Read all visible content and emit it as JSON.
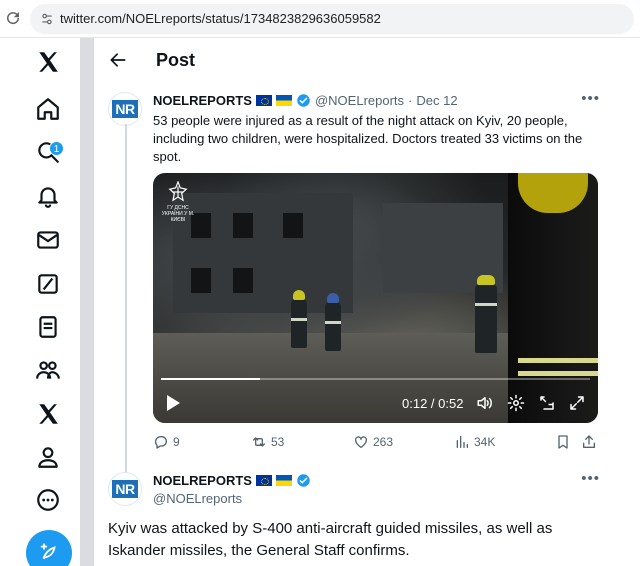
{
  "browser": {
    "url": "twitter.com/NOELreports/status/1734823829636059582"
  },
  "nav": {
    "items": [
      {
        "name": "x-logo"
      },
      {
        "name": "home"
      },
      {
        "name": "explore"
      },
      {
        "name": "notifications"
      },
      {
        "name": "messages"
      },
      {
        "name": "grok"
      },
      {
        "name": "lists"
      },
      {
        "name": "communities"
      },
      {
        "name": "premium"
      },
      {
        "name": "profile"
      },
      {
        "name": "more"
      }
    ],
    "notification_count": "1",
    "accent_color": "#1d9bf0"
  },
  "header": {
    "title": "Post"
  },
  "tweet1": {
    "name": "NOELREPORTS",
    "handle": "@NOELreports",
    "dot": "·",
    "date": "Dec 12",
    "avatar_text": "NR",
    "text": "53 people were injured as a result of the night attack on Kyiv, 20 people, including two children, were hospitalized. Doctors treated 33 victims on the spot.",
    "video": {
      "emblem_text": "ГУ ДСНС УКРАЇНИ У М. КИЄВІ",
      "timecode": "0:12 / 0:52",
      "progress": 0.23
    },
    "stats": {
      "replies": "9",
      "reposts": "53",
      "likes": "263",
      "views": "34K"
    }
  },
  "tweet2": {
    "name": "NOELREPORTS",
    "handle": "@NOELreports",
    "avatar_text": "NR",
    "text": "Kyiv was attacked by S-400 anti-aircraft guided missiles, as well as Iskander missiles, the General Staff confirms."
  }
}
